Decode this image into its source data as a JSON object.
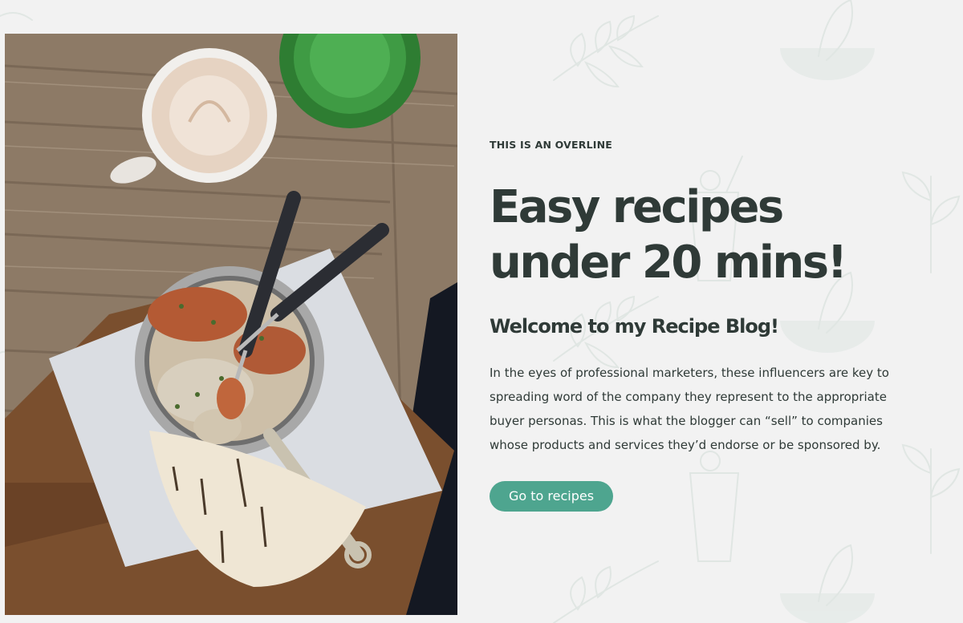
{
  "hero": {
    "image_alt": "Overhead photo of a latte, green glass, and a pan of food with flatbread on a wooden table",
    "overline": "THIS IS AN OVERLINE",
    "title": "Easy recipes under 20 mins!",
    "subtitle": "Welcome to my Recipe Blog!",
    "body": "In the eyes of professional marketers, these influencers are key to spreading word of the company they represent to the appropriate buyer personas. This is what the blogger can “sell” to companies whose products and services they’d endorse or be sponsored by.",
    "cta_label": "Go to recipes"
  },
  "colors": {
    "background": "#f2f2f2",
    "text": "#2f3a37",
    "accent": "#4ea58f",
    "pattern": "#dde3e0"
  },
  "icons": [
    "leaf-sprig-icon",
    "bowl-icon",
    "smoothie-glass-icon",
    "plant-icon"
  ]
}
